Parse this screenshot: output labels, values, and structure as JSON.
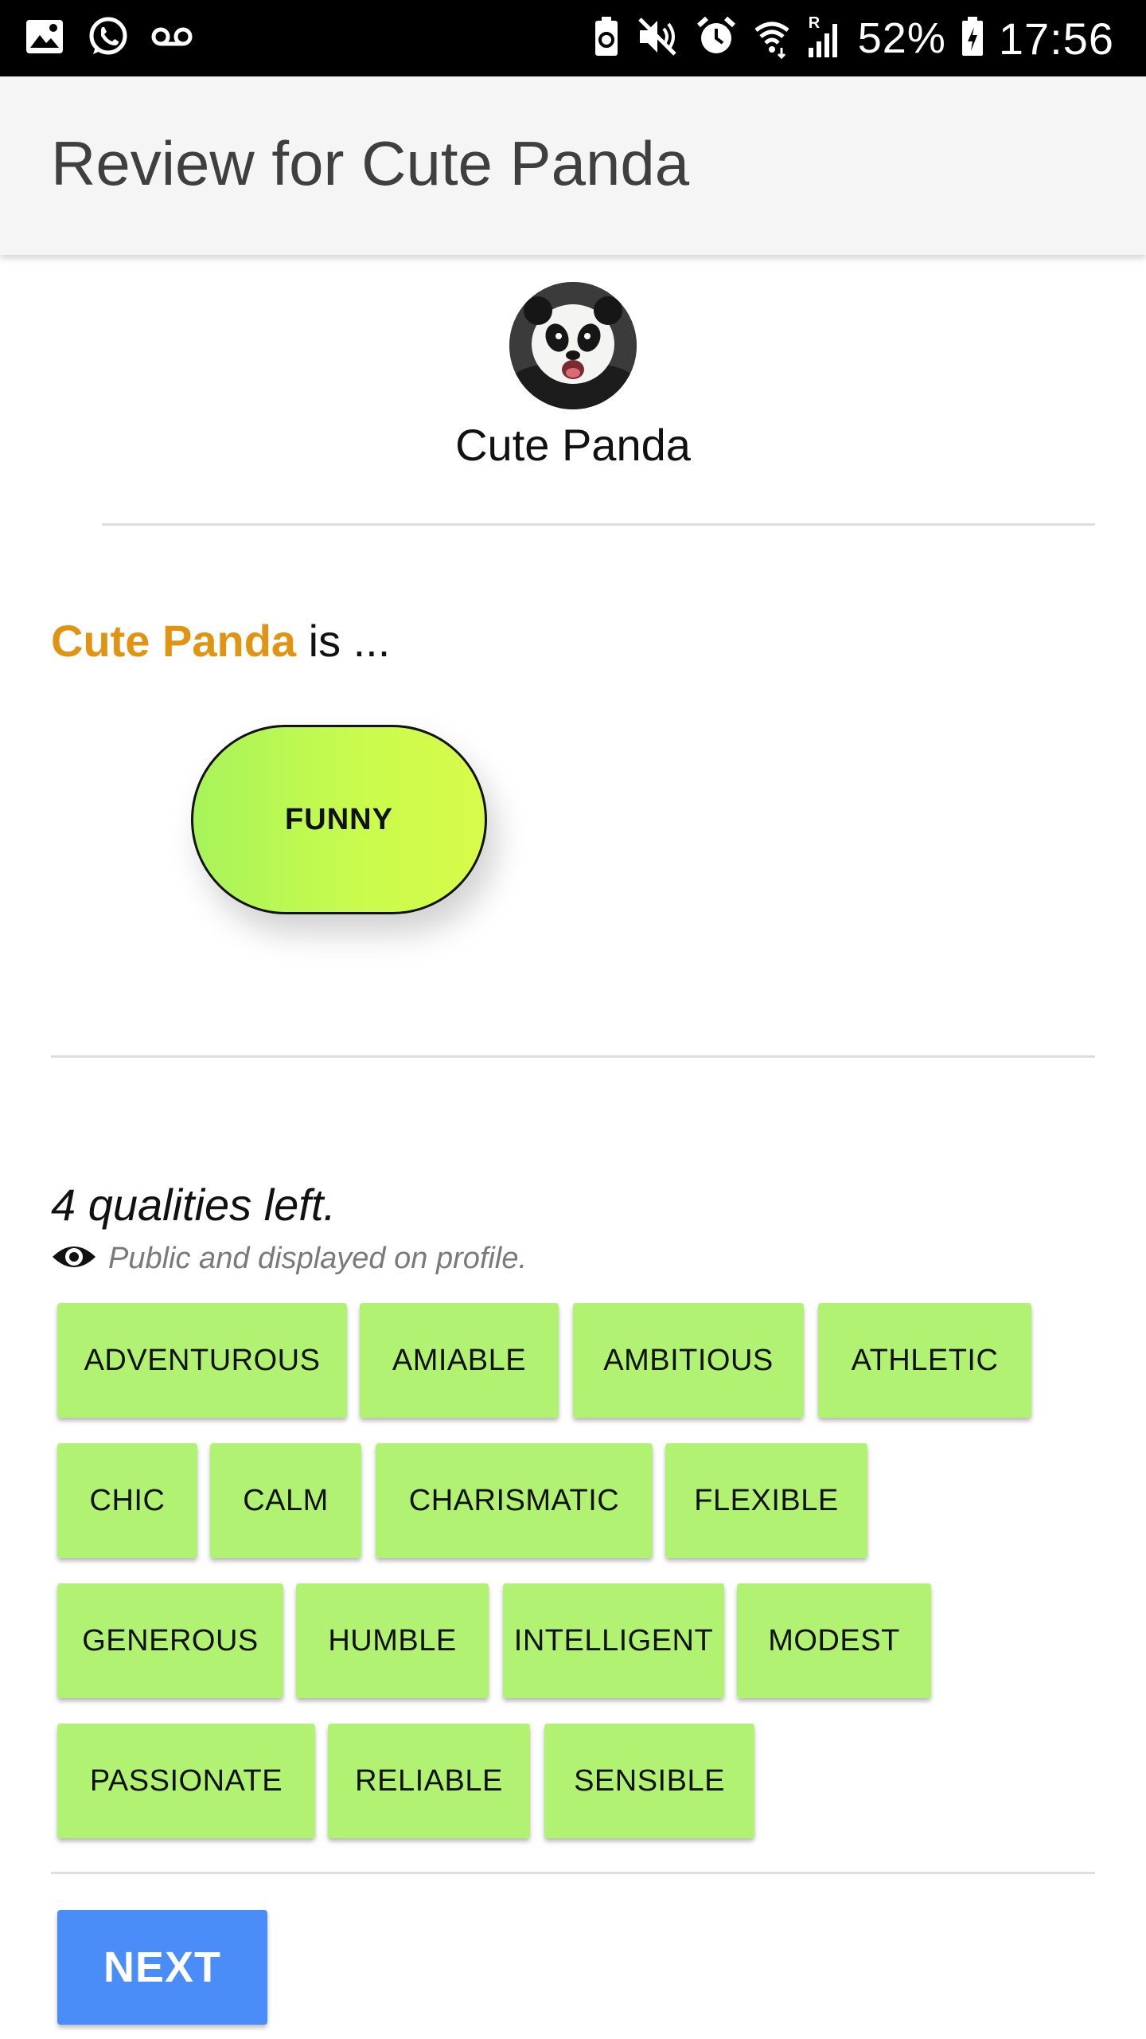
{
  "status_bar": {
    "left_icons": [
      "gallery-icon",
      "whatsapp-icon",
      "voicemail-icon"
    ],
    "right_icons": [
      "battery-saver-icon",
      "mute-icon",
      "alarm-icon",
      "wifi-icon",
      "signal-icon",
      "battery-icon"
    ],
    "signal_roaming": "R",
    "battery_percent": "52%",
    "time": "17:56"
  },
  "app_bar": {
    "title": "Review for Cute Panda"
  },
  "profile": {
    "avatar_icon": "panda-avatar",
    "name": "Cute Panda"
  },
  "review": {
    "subject": "Cute Panda",
    "is_text": " is ...",
    "selected_qualities": [
      "FUNNY"
    ],
    "selected_color_start": "#a8f35a",
    "selected_color_end": "#d8fb4a"
  },
  "qualities": {
    "left_text": "4 qualities left.",
    "privacy_icon": "eye-icon",
    "privacy_text": "Public and displayed on profile.",
    "chip_color": "#b2f272",
    "rows": [
      [
        "ADVENTUROUS",
        "AMIABLE",
        "AMBITIOUS",
        "ATHLETIC"
      ],
      [
        "CHIC",
        "CALM",
        "CHARISMATIC",
        "FLEXIBLE"
      ],
      [
        "GENEROUS",
        "HUMBLE",
        "INTELLIGENT",
        "MODEST"
      ],
      [
        "PASSIONATE",
        "RELIABLE",
        "SENSIBLE"
      ]
    ]
  },
  "actions": {
    "next_label": "NEXT",
    "next_color": "#4a8cf8"
  },
  "colors": {
    "accent_name": "#e09412"
  }
}
